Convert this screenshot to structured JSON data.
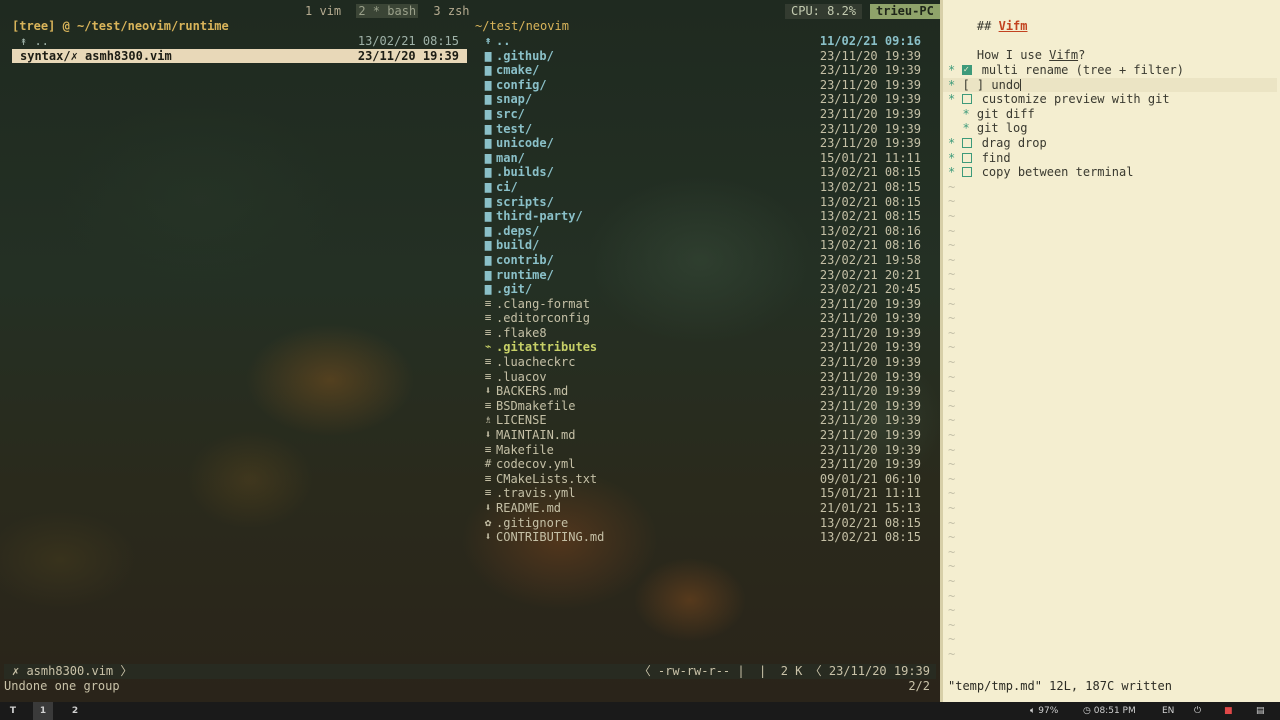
{
  "tmux": {
    "windows": [
      {
        "label": "1 vim",
        "state": "normal"
      },
      {
        "label": "2 * bash",
        "state": "current"
      },
      {
        "label": "3 zsh",
        "state": "normal"
      }
    ],
    "cpu": "CPU: 8.2%",
    "host": "trieu-PC"
  },
  "left_pane": {
    "path": "[tree] @ ~/test/neovim/runtime",
    "rows": [
      {
        "name": "↟ ..",
        "date": "13/02/21 08:15",
        "type": "parent"
      },
      {
        "name": "syntax/✗ asmh8300.vim",
        "date": "23/11/20 19:39",
        "type": "selected"
      }
    ]
  },
  "mid_pane": {
    "path": "~/test/neovim",
    "rows": [
      {
        "icon": "↟",
        "name": "..",
        "date": "11/02/21 09:16",
        "type": "parent"
      },
      {
        "icon": "▆",
        "name": ".github/",
        "date": "23/11/20 19:39",
        "type": "dir"
      },
      {
        "icon": "▆",
        "name": "cmake/",
        "date": "23/11/20 19:39",
        "type": "dir"
      },
      {
        "icon": "▆",
        "name": "config/",
        "date": "23/11/20 19:39",
        "type": "dir"
      },
      {
        "icon": "▆",
        "name": "snap/",
        "date": "23/11/20 19:39",
        "type": "dir"
      },
      {
        "icon": "▆",
        "name": "src/",
        "date": "23/11/20 19:39",
        "type": "dir"
      },
      {
        "icon": "▆",
        "name": "test/",
        "date": "23/11/20 19:39",
        "type": "dir"
      },
      {
        "icon": "▆",
        "name": "unicode/",
        "date": "23/11/20 19:39",
        "type": "dir"
      },
      {
        "icon": "▆",
        "name": "man/",
        "date": "15/01/21 11:11",
        "type": "dir"
      },
      {
        "icon": "▆",
        "name": ".builds/",
        "date": "13/02/21 08:15",
        "type": "dir"
      },
      {
        "icon": "▆",
        "name": "ci/",
        "date": "13/02/21 08:15",
        "type": "dir"
      },
      {
        "icon": "▆",
        "name": "scripts/",
        "date": "13/02/21 08:15",
        "type": "dir"
      },
      {
        "icon": "▆",
        "name": "third-party/",
        "date": "13/02/21 08:15",
        "type": "dir"
      },
      {
        "icon": "▆",
        "name": ".deps/",
        "date": "13/02/21 08:16",
        "type": "dir"
      },
      {
        "icon": "▆",
        "name": "build/",
        "date": "13/02/21 08:16",
        "type": "dir"
      },
      {
        "icon": "▆",
        "name": "contrib/",
        "date": "23/02/21 19:58",
        "type": "dir"
      },
      {
        "icon": "▆",
        "name": "runtime/",
        "date": "23/02/21 20:21",
        "type": "dir"
      },
      {
        "icon": "▆",
        "name": ".git/",
        "date": "23/02/21 20:45",
        "type": "dir"
      },
      {
        "icon": "≡",
        "name": ".clang-format",
        "date": "23/11/20 19:39",
        "type": "file"
      },
      {
        "icon": "≡",
        "name": ".editorconfig",
        "date": "23/11/20 19:39",
        "type": "file"
      },
      {
        "icon": "≡",
        "name": ".flake8",
        "date": "23/11/20 19:39",
        "type": "file"
      },
      {
        "icon": "⌁",
        "name": ".gitattributes",
        "date": "23/11/20 19:39",
        "type": "special"
      },
      {
        "icon": "≡",
        "name": ".luacheckrc",
        "date": "23/11/20 19:39",
        "type": "file"
      },
      {
        "icon": "≡",
        "name": ".luacov",
        "date": "23/11/20 19:39",
        "type": "file"
      },
      {
        "icon": "⬇",
        "name": "BACKERS.md",
        "date": "23/11/20 19:39",
        "type": "file"
      },
      {
        "icon": "≡",
        "name": "BSDmakefile",
        "date": "23/11/20 19:39",
        "type": "file"
      },
      {
        "icon": "♗",
        "name": "LICENSE",
        "date": "23/11/20 19:39",
        "type": "file"
      },
      {
        "icon": "⬇",
        "name": "MAINTAIN.md",
        "date": "23/11/20 19:39",
        "type": "file"
      },
      {
        "icon": "≡",
        "name": "Makefile",
        "date": "23/11/20 19:39",
        "type": "file"
      },
      {
        "icon": "#",
        "name": "codecov.yml",
        "date": "23/11/20 19:39",
        "type": "file"
      },
      {
        "icon": "≡",
        "name": "CMakeLists.txt",
        "date": "09/01/21 06:10",
        "type": "file"
      },
      {
        "icon": "≡",
        "name": ".travis.yml",
        "date": "15/01/21 11:11",
        "type": "file"
      },
      {
        "icon": "⬇",
        "name": "README.md",
        "date": "21/01/21 15:13",
        "type": "file"
      },
      {
        "icon": "✿",
        "name": ".gitignore",
        "date": "13/02/21 08:15",
        "type": "file"
      },
      {
        "icon": "⬇",
        "name": "CONTRIBUTING.md",
        "date": "13/02/21 08:15",
        "type": "file"
      }
    ]
  },
  "status": {
    "left": "✗ asmh8300.vim 〉",
    "right": "〈 -rw-rw-r-- |  |  2 K 〈 23/11/20 19:39",
    "message": "Undone one group",
    "count": "2/2"
  },
  "editor": {
    "heading_prefix": "## ",
    "heading_link": "Vifm",
    "line_how_prefix": "How I use ",
    "line_how_link": "Vifm",
    "line_how_suffix": "?",
    "items": [
      {
        "indent": 0,
        "check": "done",
        "text": "multi rename (tree + filter)"
      },
      {
        "indent": 0,
        "check": "raw",
        "text": "[ ] undo"
      },
      {
        "indent": 0,
        "check": "empty",
        "text": "customize preview with git"
      },
      {
        "indent": 1,
        "check": "none",
        "text": "git diff"
      },
      {
        "indent": 1,
        "check": "none",
        "text": "git log"
      },
      {
        "indent": 0,
        "check": "empty",
        "text": "drag drop"
      },
      {
        "indent": 0,
        "check": "empty",
        "text": "find"
      },
      {
        "indent": 0,
        "check": "empty",
        "text": "copy between terminal"
      }
    ],
    "bullet": "*",
    "tilde": "~",
    "message": "\"temp/tmp.md\" 12L, 187C written"
  },
  "taskbar": {
    "workspaces": [
      "T",
      "1",
      "2"
    ],
    "volume": "97%",
    "time": "08:51 PM",
    "lang": "EN"
  }
}
